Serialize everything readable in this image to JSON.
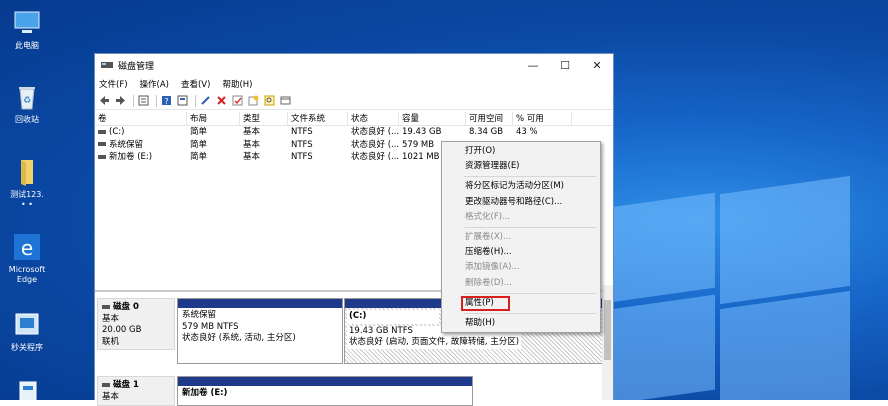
{
  "desktop": {
    "icons": [
      {
        "label": "此电脑",
        "icon": "this-pc-icon"
      },
      {
        "label": "回收站",
        "icon": "recycle-bin-icon"
      },
      {
        "label": "测试123.",
        "label2": "• •",
        "icon": "folder-icon"
      },
      {
        "label": "Microsoft",
        "label2": "Edge",
        "icon": "edge-icon"
      },
      {
        "label": "秒关程序",
        "icon": "app-icon"
      }
    ],
    "colors": {
      "background": "#0b4aa6",
      "accent": "#2e8fe6"
    }
  },
  "window": {
    "title": "磁盘管理",
    "controls": {
      "minimize": "—",
      "maximize": "☐",
      "close": "✕"
    },
    "menu": [
      "文件(F)",
      "操作(A)",
      "查看(V)",
      "帮助(H)"
    ],
    "toolbar_icons": [
      "back-icon",
      "forward-icon",
      "list-icon",
      "help-icon",
      "properties-icon",
      "connect-icon",
      "delete-icon",
      "check-icon",
      "new-icon",
      "search-icon",
      "view-icon"
    ]
  },
  "volumes": {
    "headers": [
      "卷",
      "布局",
      "类型",
      "文件系统",
      "状态",
      "容量",
      "可用空间",
      "% 可用"
    ],
    "rows": [
      [
        "(C:)",
        "简单",
        "基本",
        "NTFS",
        "状态良好 (...",
        "19.43 GB",
        "8.34 GB",
        "43 %"
      ],
      [
        "系统保留",
        "简单",
        "基本",
        "NTFS",
        "状态良好 (...",
        "579 MB",
        "",
        ""
      ],
      [
        "新加卷 (E:)",
        "简单",
        "基本",
        "NTFS",
        "状态良好 (...",
        "1021 MB",
        "",
        ""
      ]
    ]
  },
  "disks": [
    {
      "name": "磁盘 0",
      "type": "基本",
      "size": "20.00 GB",
      "status": "联机",
      "partitions": [
        {
          "name": "系统保留",
          "size": "579 MB NTFS",
          "status": "状态良好 (系统, 活动, 主分区)"
        },
        {
          "name": "(C:)",
          "size": "19.43 GB NTFS",
          "status": "状态良好 (启动, 页面文件, 故障转储, 主分区)"
        }
      ]
    },
    {
      "name": "磁盘 1",
      "type": "基本",
      "partitions": [
        {
          "name": "新加卷 (E:)"
        }
      ]
    }
  ],
  "context_menu": {
    "items": [
      {
        "label": "打开(O)",
        "enabled": true
      },
      {
        "label": "资源管理器(E)",
        "enabled": true
      },
      {
        "sep": true
      },
      {
        "label": "将分区标记为活动分区(M)",
        "enabled": true
      },
      {
        "label": "更改驱动器号和路径(C)...",
        "enabled": true
      },
      {
        "label": "格式化(F)...",
        "enabled": false
      },
      {
        "sep": true
      },
      {
        "label": "扩展卷(X)...",
        "enabled": false
      },
      {
        "label": "压缩卷(H)...",
        "enabled": true
      },
      {
        "label": "添加镜像(A)...",
        "enabled": false
      },
      {
        "label": "删除卷(D)...",
        "enabled": false
      },
      {
        "sep": true
      },
      {
        "label": "属性(P)",
        "enabled": true,
        "highlighted": true
      },
      {
        "sep": true
      },
      {
        "label": "帮助(H)",
        "enabled": true
      }
    ]
  }
}
